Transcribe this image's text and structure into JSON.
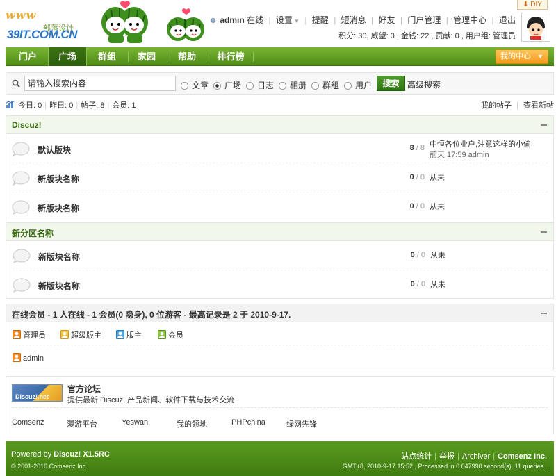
{
  "brand": {
    "www": "www",
    "domain": "39IT.COM.CN",
    "subtitle": "部落设计"
  },
  "diy_label": "DIY",
  "topbar": {
    "username": "admin",
    "online_status": "在线",
    "links": [
      "设置",
      "提醒",
      "短消息",
      "好友",
      "门户管理",
      "管理中心",
      "退出"
    ],
    "credits_text": "积分: 30, 威望: 0 , 金钱: 22 , 贡献: 0 , 用户组: 管理员"
  },
  "nav": {
    "items": [
      "门户",
      "广场",
      "群组",
      "家园",
      "帮助",
      "排行榜"
    ],
    "active": "广场",
    "user_center": "我的中心"
  },
  "search": {
    "placeholder": "请输入搜索内容",
    "options": [
      "文章",
      "广场",
      "日志",
      "相册",
      "群组",
      "用户"
    ],
    "selected": "广场",
    "button": "搜索",
    "advanced": "高级搜索"
  },
  "stats": {
    "today": "今日: 0",
    "yesterday": "昨日: 0",
    "posts": "帖子: 8",
    "members": "会员: 1",
    "my_posts": "我的帖子",
    "new_posts": "查看新帖"
  },
  "categories": [
    {
      "title": "Discuz!",
      "forums": [
        {
          "name": "默认版块",
          "threads": "8",
          "posts": "8",
          "last_title": "中恒各位业户,注意这样的小偷",
          "last_meta": "前天 17:59 admin"
        },
        {
          "name": "新版块名称",
          "threads": "0",
          "posts": "0",
          "last_title": "从未",
          "last_meta": ""
        },
        {
          "name": "新版块名称",
          "threads": "0",
          "posts": "0",
          "last_title": "从未",
          "last_meta": ""
        }
      ]
    },
    {
      "title": "新分区名称",
      "forums": [
        {
          "name": "新版块名称",
          "threads": "0",
          "posts": "0",
          "last_title": "从未",
          "last_meta": ""
        },
        {
          "name": "新版块名称",
          "threads": "0",
          "posts": "0",
          "last_title": "从未",
          "last_meta": ""
        }
      ]
    }
  ],
  "online": {
    "title": "在线会员",
    "summary": "- 1 人在线  - 1 会员(0 隐身), 0 位游客  - 最高记录是  2 于  2010-9-17.",
    "legend": [
      "管理员",
      "超级版主",
      "版主",
      "会员"
    ],
    "users": [
      "admin"
    ]
  },
  "links": {
    "logo_text": "Discuz!.net",
    "title": "官方论坛",
    "desc": "提供最新  Discuz! 产品新闻、软件下载与技术交流",
    "items": [
      "Comsenz",
      "漫游平台",
      "Yeswan",
      "我的领地",
      "PHPchina",
      "绿网先锋"
    ]
  },
  "footer": {
    "powered": "Powered by",
    "product": "Discuz! X1.5RC",
    "copyright": "© 2001-2010 Comsenz Inc.",
    "links": [
      "站点统计",
      "举报",
      "Archiver"
    ],
    "company": "Comsenz Inc.",
    "gmt": "GMT+8, 2010-9-17 15:52 , Processed in 0.047990 second(s), 11 queries ."
  },
  "colors": {
    "brand_green": "#4d8b17",
    "accent_orange": "#f29a1c",
    "link_blue": "#2c78c7"
  }
}
